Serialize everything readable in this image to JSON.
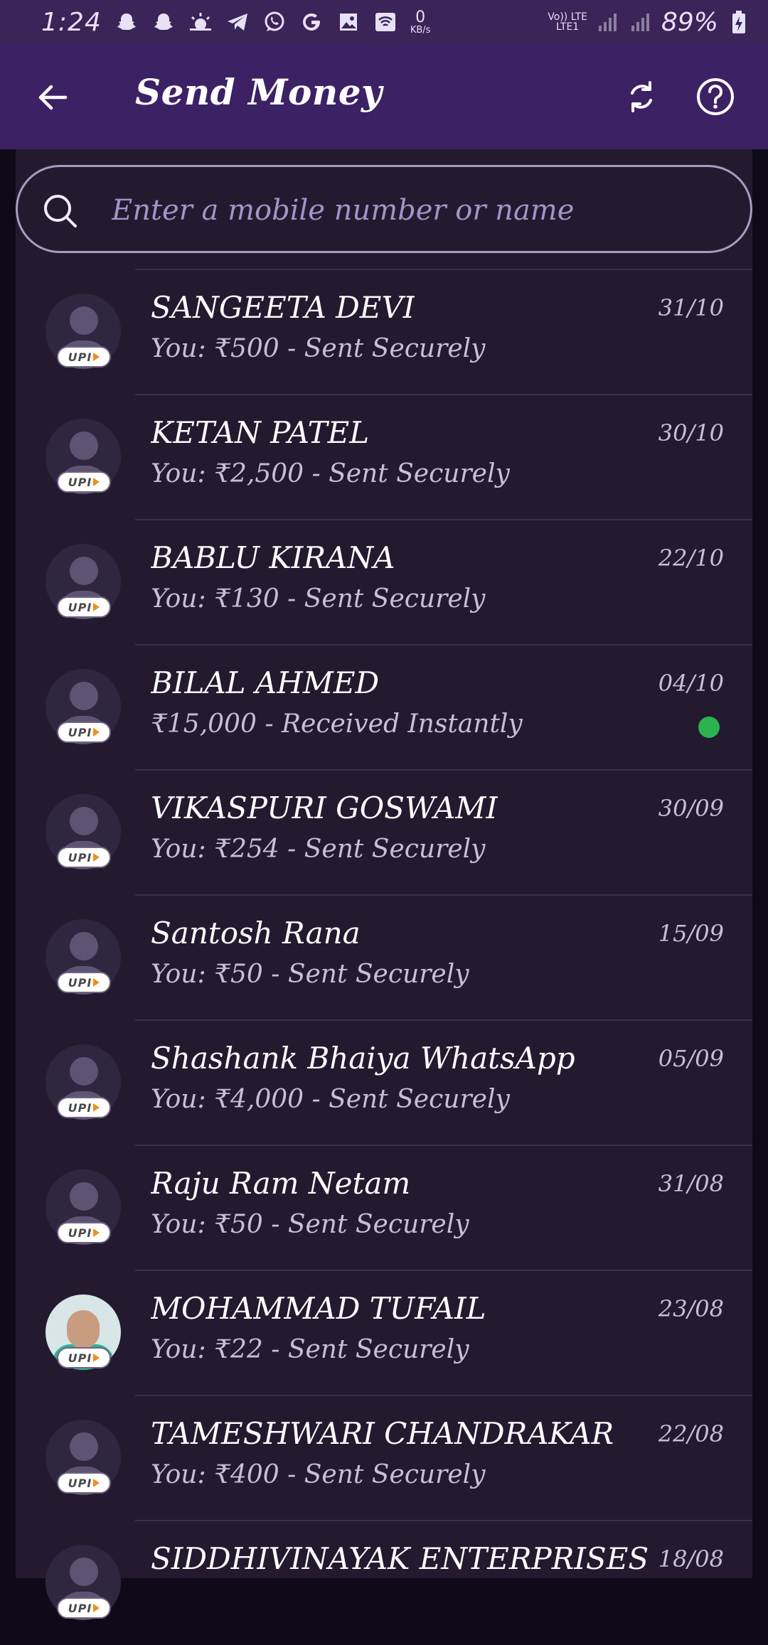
{
  "status_bar": {
    "time": "1:24",
    "data_speed_value": "0",
    "data_speed_unit": "KB/s",
    "net_top": "Vo)) LTE",
    "net_bottom": "LTE1",
    "battery": "89%"
  },
  "header": {
    "title": "Send Money"
  },
  "search": {
    "placeholder": "Enter a mobile number or name"
  },
  "badge_label": "UPI",
  "accent_color": "#3d2165",
  "received_dot_color": "#2bb34f",
  "contacts": [
    {
      "name": "SANGEETA DEVI",
      "subtitle": "You: ₹500 - Sent Securely",
      "date": "31/10"
    },
    {
      "name": "KETAN PATEL",
      "subtitle": "You: ₹2,500 - Sent Securely",
      "date": "30/10"
    },
    {
      "name": "BABLU KIRANA",
      "subtitle": "You: ₹130 - Sent Securely",
      "date": "22/10"
    },
    {
      "name": "BILAL AHMED",
      "subtitle": "₹15,000 - Received Instantly",
      "date": "04/10"
    },
    {
      "name": "VIKASPURI GOSWAMI",
      "subtitle": "You: ₹254 - Sent Securely",
      "date": "30/09"
    },
    {
      "name": "Santosh Rana",
      "subtitle": "You: ₹50 - Sent Securely",
      "date": "15/09"
    },
    {
      "name": "Shashank Bhaiya WhatsApp",
      "subtitle": "You: ₹4,000 - Sent Securely",
      "date": "05/09"
    },
    {
      "name": "Raju Ram Netam",
      "subtitle": "You: ₹50 - Sent Securely",
      "date": "31/08"
    },
    {
      "name": "MOHAMMAD TUFAIL",
      "subtitle": "You: ₹22 - Sent Securely",
      "date": "23/08"
    },
    {
      "name": "TAMESHWARI CHANDRAKAR",
      "subtitle": "You: ₹400 - Sent Securely",
      "date": "22/08"
    },
    {
      "name": "SIDDHIVINAYAK ENTERPRISES",
      "subtitle": "",
      "date": "18/08"
    }
  ]
}
